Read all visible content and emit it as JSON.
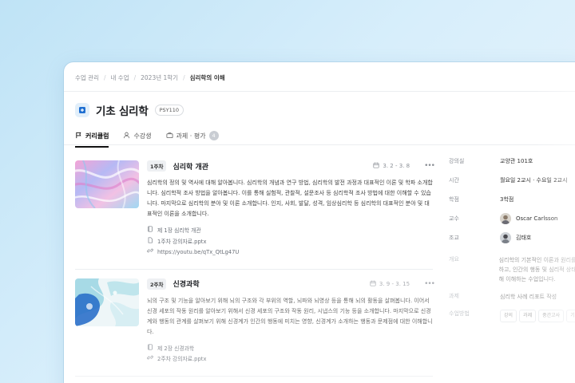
{
  "breadcrumb": [
    "수업 관리",
    "내 수업",
    "2023년 1학기",
    "심리학의 이해"
  ],
  "course": {
    "title": "기초 심리학",
    "code": "PSY110"
  },
  "tabs": [
    {
      "label": "커리큘럼",
      "icon": "flag-icon"
    },
    {
      "label": "수강생",
      "icon": "user-icon"
    },
    {
      "label": "과제 · 평가",
      "icon": "briefcase-icon",
      "count": "4"
    }
  ],
  "weeks": [
    {
      "badge": "1주차",
      "title": "심리학 개관",
      "date": "3. 2 - 3. 8",
      "description": "심리학의 정의 및 역사에 대해 알아봅니다. 심리학의 개념과 연구 방법, 심리학의 발전 과정과 대표적인 이론 및 학파 소개합니다. 심리학적 조사 방법을 알아봅니다. 이를 통해 실험적, 관찰적, 설문조사 등 심리학적 조사 방법에 대한 이해할 수 있습니다. 마지막으로 심리학의 분야 및 이론 소개합니다. 인지, 사회, 발달, 성격, 임상심리학 등 심리학의 대표적인 분야 및 대표적인 이론을 소개합니다.",
      "attachments": [
        {
          "icon": "book-icon",
          "text": "제 1장 심리학 개관"
        },
        {
          "icon": "file-icon",
          "text": "1주차 강의자료.pptx"
        },
        {
          "icon": "link-icon",
          "text": "https://youtu.be/qTx_QtLg47U"
        }
      ]
    },
    {
      "badge": "2주차",
      "title": "신경과학",
      "date": "3. 9 - 3. 15",
      "description": "뇌의 구조 및 기능을 알아보기 위해 뇌의 구조와 각 부위의 역할, 뇌파와 뇌영상 등을 통해 뇌의 활동을 살펴봅니다. 이어서 신경 세포의 작동 원리를 알아보기 위해서 신경 세포의 구조와 작동 원리, 시냅스의 기능 등을 소개합니다. 마지막으로 신경계와 행동의 관계를 살펴보기 위해 신경계가 인간의 행동에 미치는 영향, 신경계가 소개하는 행동과 문제점에 대한 이해합니다.",
      "attachments": [
        {
          "icon": "book-icon",
          "text": "제 2장 신경과학"
        },
        {
          "icon": "link-icon",
          "text": "2주차 강의자료.pptx"
        }
      ]
    }
  ],
  "info": [
    {
      "label": "강의실",
      "value": "교양관 101호"
    },
    {
      "label": "시간",
      "value": "월요일 2교시 · 수요일 2교시"
    },
    {
      "label": "학점",
      "value": "3학점"
    },
    {
      "label": "교수",
      "value": "Oscar Carlsson"
    },
    {
      "label": "조교",
      "value": "김태호"
    }
  ],
  "extra": {
    "summary_label": "개요",
    "summary_value": "심리학의 기본적인 이론과 원리를 학습하고, 인간의 행동 및 심리적 상태에 대해 이해하는 수업입니다.",
    "assignment_label": "과제",
    "assignment_value": "심리학 사례 리포트 작성",
    "method_label": "수업방법",
    "tags": [
      "강의",
      "과제",
      "중간고사",
      "기"
    ]
  },
  "colors": {
    "accent": "#1f6fd1",
    "text": "#1d1f23",
    "muted": "#8b8f96"
  }
}
